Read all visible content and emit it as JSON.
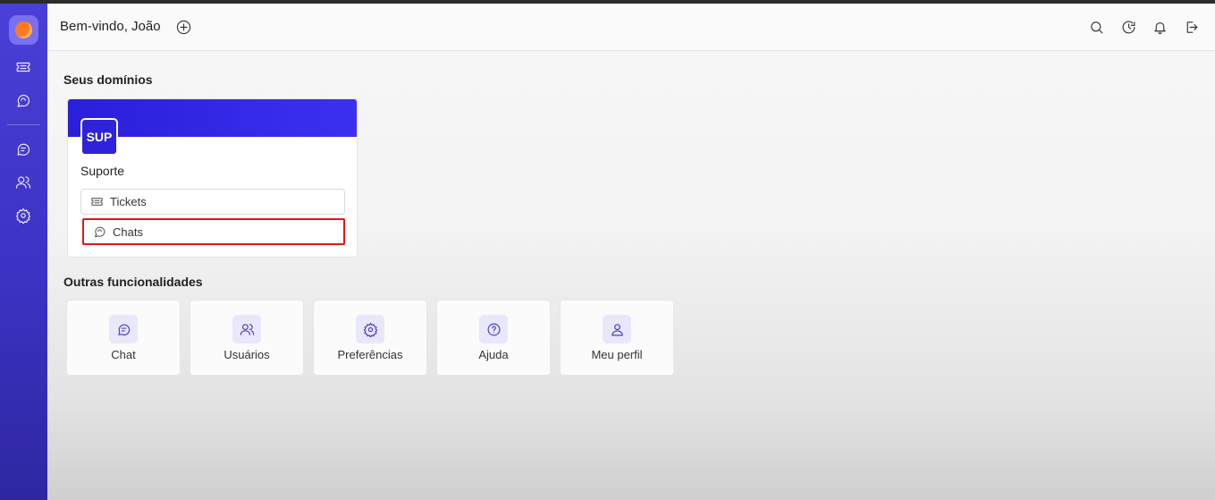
{
  "header": {
    "welcome": "Bem-vindo, João"
  },
  "domains": {
    "title": "Seus domínios",
    "card": {
      "badge": "SUP",
      "name": "Suporte",
      "links": [
        {
          "label": "Tickets",
          "icon": "ticket-icon"
        },
        {
          "label": "Chats",
          "icon": "chat-bubble-icon",
          "highlighted": true
        }
      ]
    }
  },
  "features": {
    "title": "Outras funcionalidades",
    "items": [
      {
        "label": "Chat",
        "icon": "chat-icon"
      },
      {
        "label": "Usuários",
        "icon": "users-icon"
      },
      {
        "label": "Preferências",
        "icon": "gear-icon"
      },
      {
        "label": "Ajuda",
        "icon": "help-icon"
      },
      {
        "label": "Meu perfil",
        "icon": "user-icon"
      }
    ]
  },
  "colors": {
    "sidebar": "#3c32c4",
    "brand": "#2e23d8",
    "highlight": "#e01818",
    "logo_accent": "#ff7a1a"
  }
}
